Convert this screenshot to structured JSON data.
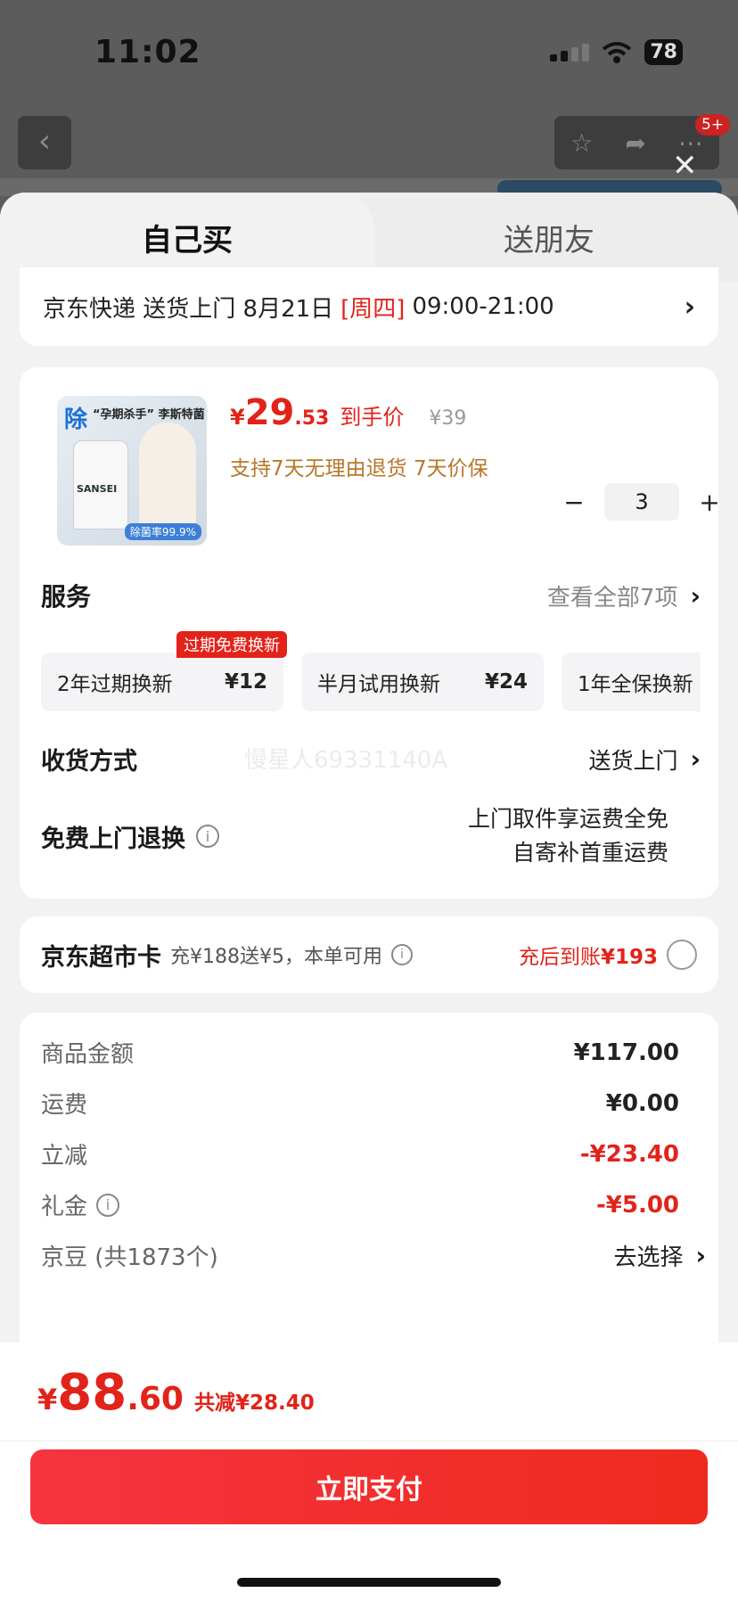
{
  "status_bar": {
    "time": "11:02",
    "battery": "78"
  },
  "background": {
    "badge": "5+"
  },
  "tabs": [
    {
      "label": "自己买"
    },
    {
      "label": "送朋友"
    }
  ],
  "delivery": {
    "prefix": "京东快递 送货上门 8月21日",
    "weekday": "[周四]",
    "time_range": "09:00-21:00"
  },
  "product": {
    "image_tag": "除",
    "image_caption": "“孕期杀手” 李斯特菌",
    "image_brand": "SANSEI",
    "image_rate": "除菌率99.9%",
    "price_yen": "¥",
    "price_int": "29",
    "price_dec": ".53",
    "price_label": "到手价",
    "original_price": "¥39",
    "guarantee": "支持7天无理由退货  7天价保",
    "quantity": "3",
    "minus": "−",
    "plus": "+"
  },
  "services": {
    "title": "服务",
    "view_all": "查看全部7项",
    "badge": "过期免费换新",
    "items": [
      {
        "name": "2年过期换新",
        "price": "¥12"
      },
      {
        "name": "半月试用换新",
        "price": "¥24"
      },
      {
        "name": "1年全保换新",
        "price": ""
      }
    ]
  },
  "shipping": {
    "label": "收货方式",
    "value": "送货上门",
    "watermark": "慢星人69331140A"
  },
  "free_return": {
    "label": "免费上门退换",
    "line1": "上门取件享运费全免",
    "line2": "自寄补首重运费"
  },
  "jd_card": {
    "title": "京东超市卡",
    "desc": "充¥188送¥5，本单可用",
    "after_text": "充后到账",
    "after_amount": "¥193"
  },
  "summary": [
    {
      "label": "商品金额",
      "value": "¥117.00",
      "style": "normal"
    },
    {
      "label": "运费",
      "value": "¥0.00",
      "style": "normal"
    },
    {
      "label": "立减",
      "value": "-¥23.40",
      "style": "red"
    },
    {
      "label": "礼金",
      "value": "-¥5.00",
      "style": "red",
      "info": true
    },
    {
      "label": "京豆 (共1873个)",
      "value": "去选择",
      "style": "link"
    }
  ],
  "footer": {
    "yen": "¥",
    "total_int": "88",
    "total_dec": ".60",
    "saved": "共减¥28.40",
    "pay_button": "立即支付"
  },
  "colors": {
    "accent_red": "#e2231a",
    "guarantee_gold": "#b8772a",
    "pay_gradient_start": "#f5343f",
    "pay_gradient_end": "#ef2a1e"
  }
}
